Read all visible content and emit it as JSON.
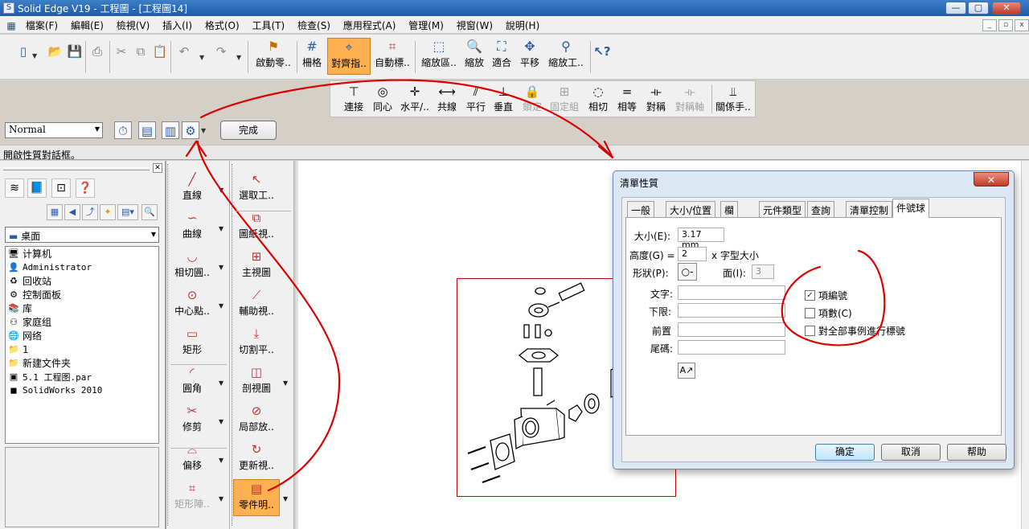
{
  "window": {
    "title": "Solid Edge V19 - 工程圖 - [工程圖14]",
    "controls": {
      "minimize": "—",
      "maximize": "▢",
      "close": "✕"
    },
    "mdi_controls": {
      "minimize": "_",
      "restore": "▫",
      "close": "x"
    }
  },
  "menubar": {
    "items": [
      "檔案(F)",
      "編輯(E)",
      "檢視(V)",
      "插入(I)",
      "格式(O)",
      "工具(T)",
      "檢查(S)",
      "應用程式(A)",
      "管理(M)",
      "視窗(W)",
      "說明(H)"
    ]
  },
  "toolbar": {
    "large_buttons": [
      "啟動零..",
      "柵格",
      "對齊指..",
      "自動標..",
      "縮放區..",
      "縮放",
      "適合",
      "平移",
      "縮放工.."
    ],
    "active": "對齊指.."
  },
  "relations_toolbar": {
    "buttons": [
      "連接",
      "同心",
      "水平/..",
      "共線",
      "平行",
      "垂直",
      "鎖定",
      "固定組",
      "相切",
      "相等",
      "對稱",
      "對稱軸",
      "關係手.."
    ],
    "disabled": [
      "鎖定",
      "固定組",
      "對稱軸"
    ]
  },
  "ribbon_bar": {
    "style_value": "Normal",
    "finish_label": "完成"
  },
  "status_bar": {
    "text": "開啟性質對話框。"
  },
  "library": {
    "location": "桌面",
    "items": [
      {
        "icon": "computer-icon",
        "label": "计算机",
        "mono": false
      },
      {
        "icon": "user-folder-icon",
        "label": "Administrator",
        "mono": true
      },
      {
        "icon": "recycle-bin-icon",
        "label": "回收站",
        "mono": false
      },
      {
        "icon": "control-panel-icon",
        "label": "控制面板",
        "mono": false
      },
      {
        "icon": "library-icon",
        "label": "库",
        "mono": false
      },
      {
        "icon": "homegroup-icon",
        "label": "家庭组",
        "mono": false
      },
      {
        "icon": "network-icon",
        "label": "网络",
        "mono": false
      },
      {
        "icon": "folder-icon",
        "label": "1",
        "mono": false
      },
      {
        "icon": "folder-icon",
        "label": "新建文件夹",
        "mono": false
      },
      {
        "icon": "par-file-icon",
        "label": "5.1 工程图.par",
        "mono": true
      },
      {
        "icon": "solidworks-icon",
        "label": "SolidWorks 2010",
        "mono": true
      }
    ]
  },
  "draw_toolbar": {
    "col1": [
      "直線",
      "曲線",
      "相切圓..",
      "中心點..",
      "矩形",
      "圓角",
      "修剪",
      "偏移",
      "矩形陣.."
    ],
    "col2": [
      "選取工..",
      "圖紙視..",
      "主視圖",
      "輔助視..",
      "切割平..",
      "剖視圖",
      "局部放..",
      "更新視..",
      "零件明.."
    ],
    "active": "零件明..",
    "disabled": [
      "矩形陣.."
    ]
  },
  "dialog": {
    "title": "清單性質",
    "close": "✕",
    "tabs": [
      "一般",
      "大小/位置",
      "欄",
      "元件類型",
      "查詢",
      "清單控制",
      "件號球"
    ],
    "active_tab": "件號球",
    "fields": {
      "size_label": "大小(E):",
      "size_value": "3.17 mm",
      "height_label": "高度(G) =",
      "height_value": "2",
      "height_suffix": "x 字型大小",
      "shape_label": "形狀(P):",
      "sides_label": "面(I):",
      "sides_value": "3",
      "text_label": "文字:",
      "lower_label": "下限:",
      "prefix_label": "前置",
      "suffix_label": "尾碼:"
    },
    "checkboxes": [
      {
        "label": "項編號",
        "checked": true
      },
      {
        "label": "項數(C)",
        "checked": false
      },
      {
        "label": "對全部事例進行標號",
        "checked": false
      }
    ],
    "buttons": {
      "ok": "确定",
      "cancel": "取消",
      "help": "帮助"
    }
  },
  "annotation_color": "#dd0000"
}
